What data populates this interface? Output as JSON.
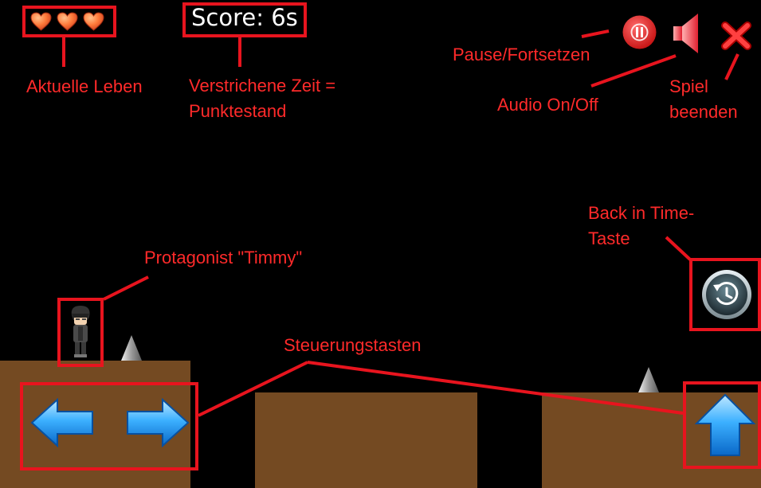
{
  "hud": {
    "lives": 3,
    "score_text": "Score: 6s"
  },
  "annotations": {
    "lives": "Aktuelle Leben",
    "time_line1": "Verstrichene Zeit =",
    "time_line2": "Punktestand",
    "pause": "Pause/Fortsetzen",
    "audio": "Audio On/Off",
    "quit_line1": "Spiel",
    "quit_line2": "beenden",
    "back_line1": "Back in Time-",
    "back_line2": "Taste",
    "protagonist": "Protagonist \"Timmy\"",
    "controls": "Steuerungstasten"
  },
  "icons": {
    "heart": "heart-icon",
    "pause": "pause-icon",
    "audio": "speaker-icon",
    "quit": "close-icon",
    "rewind": "rewind-clock-icon",
    "left": "arrow-left-icon",
    "right": "arrow-right-icon",
    "jump": "arrow-up-icon",
    "spike": "spike-icon"
  },
  "colors": {
    "annotation": "#ff2a2a",
    "ground": "#744a22",
    "arrow": "#1f9bf0",
    "pause_button": "#e02020"
  }
}
